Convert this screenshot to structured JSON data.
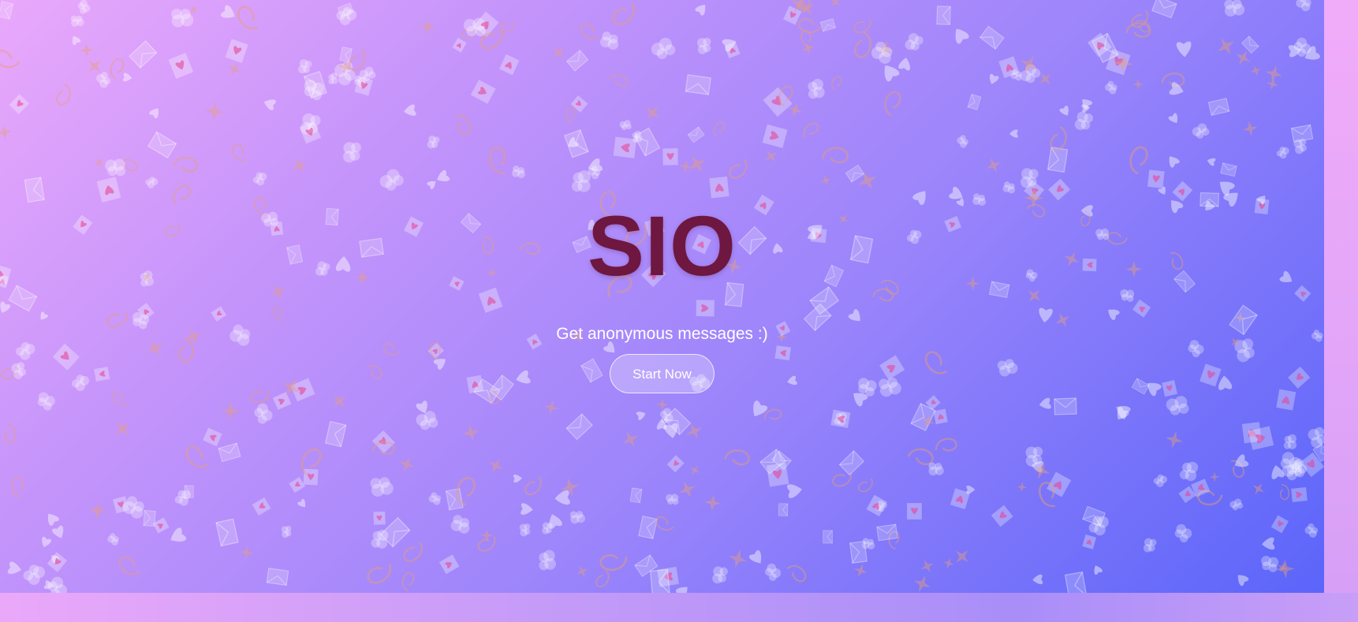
{
  "hero": {
    "title": "SIO",
    "title_color": "#6e1740",
    "subtitle": "Get anonymous messages :)",
    "cta_label": "Start Now"
  },
  "theme": {
    "gradient": [
      "#e9a8fb",
      "#c494fb",
      "#9a84fb",
      "#5b65fa"
    ],
    "pattern_icons": [
      "heart-icon",
      "envelope-icon",
      "letter-heart-icon",
      "sparkle-icon",
      "cloud-icon",
      "swirl-icon"
    ]
  }
}
